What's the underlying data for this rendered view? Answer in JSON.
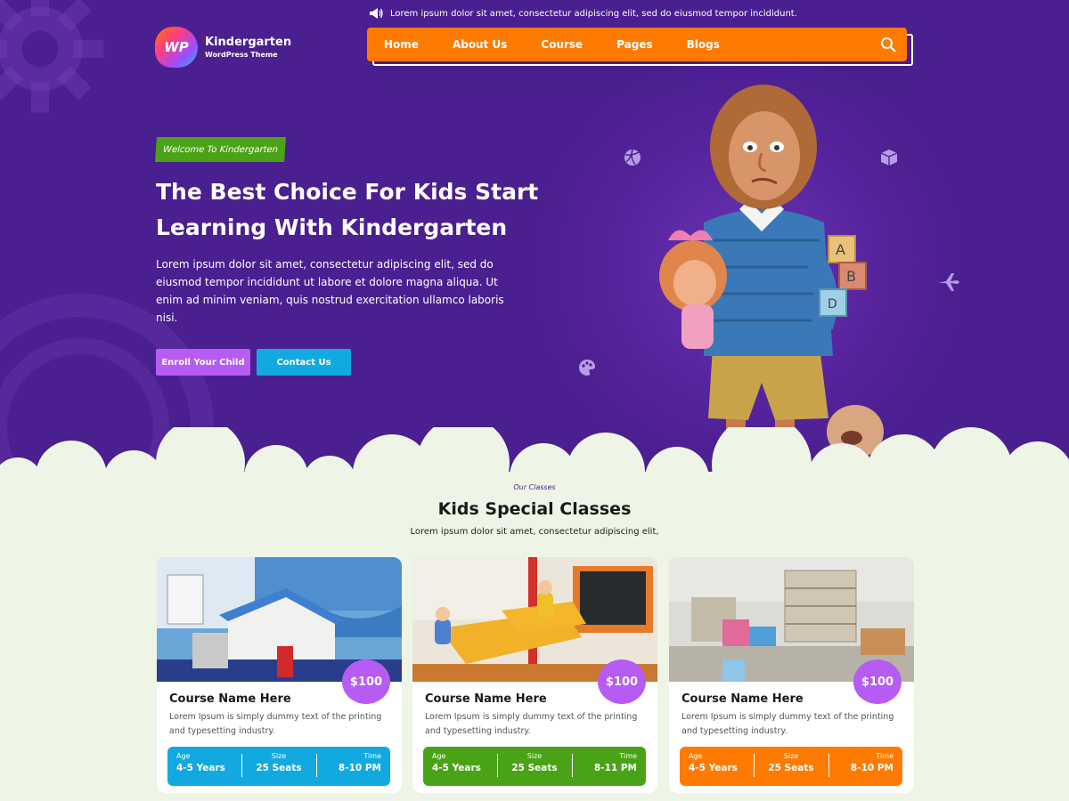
{
  "topbar": {
    "announcement": "Lorem ipsum dolor sit amet, consectetur adipiscing elit, sed do eiusmod tempor incididunt."
  },
  "logo": {
    "badge": "WP",
    "title": "Kindergarten",
    "subtitle": "WordPress Theme"
  },
  "nav": {
    "items": [
      "Home",
      "About Us",
      "Course",
      "Pages",
      "Blogs"
    ]
  },
  "hero": {
    "badge": "Welcome To Kindergarten",
    "title": "The Best Choice For Kids Start Learning With Kindergarten",
    "text": "Lorem ipsum dolor sit amet, consectetur adipiscing elit, sed do eiusmod tempor incididunt ut labore et dolore magna aliqua. Ut enim ad minim veniam, quis nostrud exercitation ullamco laboris nisi.",
    "btn_enroll": "Enroll Your Child",
    "btn_contact": "Contact Us"
  },
  "classes": {
    "kicker": "Our Classes",
    "title": "Kids Special Classes",
    "subtitle": "Lorem ipsum dolor sit amet, consectetur adipiscing elit,",
    "cards": [
      {
        "price": "$100",
        "title": "Course Name Here",
        "desc": "Lorem Ipsum is simply dummy text of the printing and typesetting industry.",
        "age_label": "Age",
        "age": "4-5 Years",
        "size_label": "Size",
        "size": "25 Seats",
        "time_label": "Time",
        "time": "8-10 PM",
        "color": "#12a9e0"
      },
      {
        "price": "$100",
        "title": "Course Name Here",
        "desc": "Lorem Ipsum is simply dummy text of the printing and typesetting industry.",
        "age_label": "Age",
        "age": "4-5 Years",
        "size_label": "Size",
        "size": "25 Seats",
        "time_label": "Time",
        "time": "8-11 PM",
        "color": "#4aa316"
      },
      {
        "price": "$100",
        "title": "Course Name Here",
        "desc": "Lorem Ipsum is simply dummy text of the printing and typesetting industry.",
        "age_label": "Age",
        "age": "4-5 Years",
        "size_label": "Size",
        "size": "25 Seats",
        "time_label": "Time",
        "time": "8-10 PM",
        "color": "#ff7a00"
      }
    ]
  },
  "colors": {
    "hero_bg": "#4a1f8f",
    "accent_orange": "#ff7a00",
    "accent_purple": "#b65cf2",
    "accent_blue": "#12a9e0",
    "accent_green": "#4aa316",
    "section_bg": "#eef5e6"
  },
  "icons": [
    "megaphone-icon",
    "search-icon",
    "volleyball-icon",
    "box-icon",
    "airplane-icon",
    "palette-icon"
  ]
}
